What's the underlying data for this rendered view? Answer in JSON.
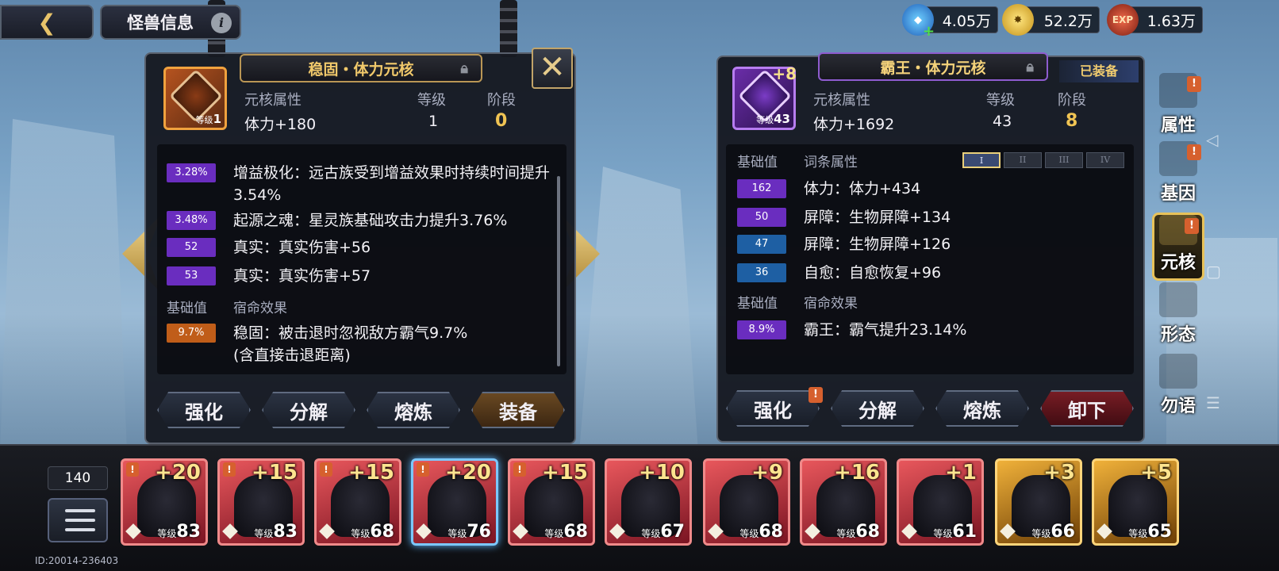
{
  "header": {
    "back_icon": "back-arrow-icon",
    "title": "怪兽信息",
    "info_icon": "i"
  },
  "currencies": [
    {
      "name": "blue-gem-icon",
      "value": "4.05万",
      "color": "#2f7fd8"
    },
    {
      "name": "gold-coin-icon",
      "value": "52.2万",
      "color": "#e0ad2a"
    },
    {
      "name": "exp-icon",
      "label": "EXP",
      "value": "1.63万",
      "color": "#b23a22"
    }
  ],
  "left_panel": {
    "title": "稳固・体力元核",
    "core_level_prefix": "等级",
    "core_level": "1",
    "attr_header": "元核属性",
    "attr_value": "体力+180",
    "level_header": "等级",
    "level_value": "1",
    "stage_header": "阶段",
    "stage_value": "0",
    "affixes": [
      {
        "badge": "3.28%",
        "badge_color": "purple",
        "text": "增益极化：远古族受到增益效果时持续时间提升3.54%"
      },
      {
        "badge": "3.48%",
        "badge_color": "purple",
        "text": "起源之魂：星灵族基础攻击力提升3.76%"
      },
      {
        "badge": "52",
        "badge_color": "purple",
        "text": "真实：真实伤害+56"
      },
      {
        "badge": "53",
        "badge_color": "purple",
        "text": "真实：真实伤害+57"
      }
    ],
    "fate_base_header": "基础值",
    "fate_header": "宿命效果",
    "fate": {
      "badge": "9.7%",
      "badge_color": "orange",
      "text": "稳固：被击退时忽视敌方霸气9.7%",
      "subtext": "(含直接击退距离)"
    },
    "buttons": {
      "enhance": "强化",
      "decompose": "分解",
      "smelt": "熔炼",
      "equip": "装备"
    }
  },
  "right_panel": {
    "title": "霸王・体力元核",
    "equipped_label": "已装备",
    "core_plus": "+8",
    "core_level_prefix": "等级",
    "core_level": "43",
    "attr_header": "元核属性",
    "attr_value": "体力+1692",
    "level_header": "等级",
    "level_value": "43",
    "stage_header": "阶段",
    "stage_value": "8",
    "base_header": "基础值",
    "affix_header": "词条属性",
    "tiers": [
      "I",
      "II",
      "III",
      "IV"
    ],
    "affixes": [
      {
        "badge": "162",
        "badge_color": "purple",
        "text": "体力：体力+434"
      },
      {
        "badge": "50",
        "badge_color": "purple",
        "text": "屏障：生物屏障+134"
      },
      {
        "badge": "47",
        "badge_color": "blue",
        "text": "屏障：生物屏障+126"
      },
      {
        "badge": "36",
        "badge_color": "blue",
        "text": "自愈：自愈恢复+96"
      }
    ],
    "fate_base_header": "基础值",
    "fate_header": "宿命效果",
    "fate": {
      "badge": "8.9%",
      "badge_color": "purple",
      "text": "霸王：霸气提升23.14%"
    },
    "buttons": {
      "enhance": "强化",
      "decompose": "分解",
      "smelt": "熔炼",
      "unequip": "卸下"
    }
  },
  "side_tabs": [
    {
      "label": "属性",
      "icon": "face-icon",
      "alert": true
    },
    {
      "label": "基因",
      "icon": "dna-icon",
      "alert": true
    },
    {
      "label": "元核",
      "icon": "core-icon",
      "alert": true,
      "active": true
    },
    {
      "label": "形态",
      "icon": "form-icon",
      "alert": false
    },
    {
      "label": "勿语",
      "icon": "whisper-icon",
      "alert": false
    }
  ],
  "bottom": {
    "count": "140",
    "id_text": "ID:20014-236403",
    "level_prefix": "等级",
    "monsters": [
      {
        "plus": "+20",
        "level": "83",
        "frame": "red",
        "alert": true
      },
      {
        "plus": "+15",
        "level": "83",
        "frame": "red",
        "alert": true
      },
      {
        "plus": "+15",
        "level": "68",
        "frame": "red",
        "alert": true
      },
      {
        "plus": "+20",
        "level": "76",
        "frame": "red",
        "alert": true,
        "selected": true
      },
      {
        "plus": "+15",
        "level": "68",
        "frame": "red",
        "alert": true
      },
      {
        "plus": "+10",
        "level": "67",
        "frame": "red",
        "alert": false
      },
      {
        "plus": "+9",
        "level": "68",
        "frame": "red",
        "alert": false
      },
      {
        "plus": "+16",
        "level": "68",
        "frame": "red",
        "alert": false
      },
      {
        "plus": "+1",
        "level": "61",
        "frame": "red",
        "alert": false
      },
      {
        "plus": "+3",
        "level": "66",
        "frame": "gold",
        "alert": false
      },
      {
        "plus": "+5",
        "level": "65",
        "frame": "gold",
        "alert": false
      }
    ]
  },
  "alert_mark": "!"
}
